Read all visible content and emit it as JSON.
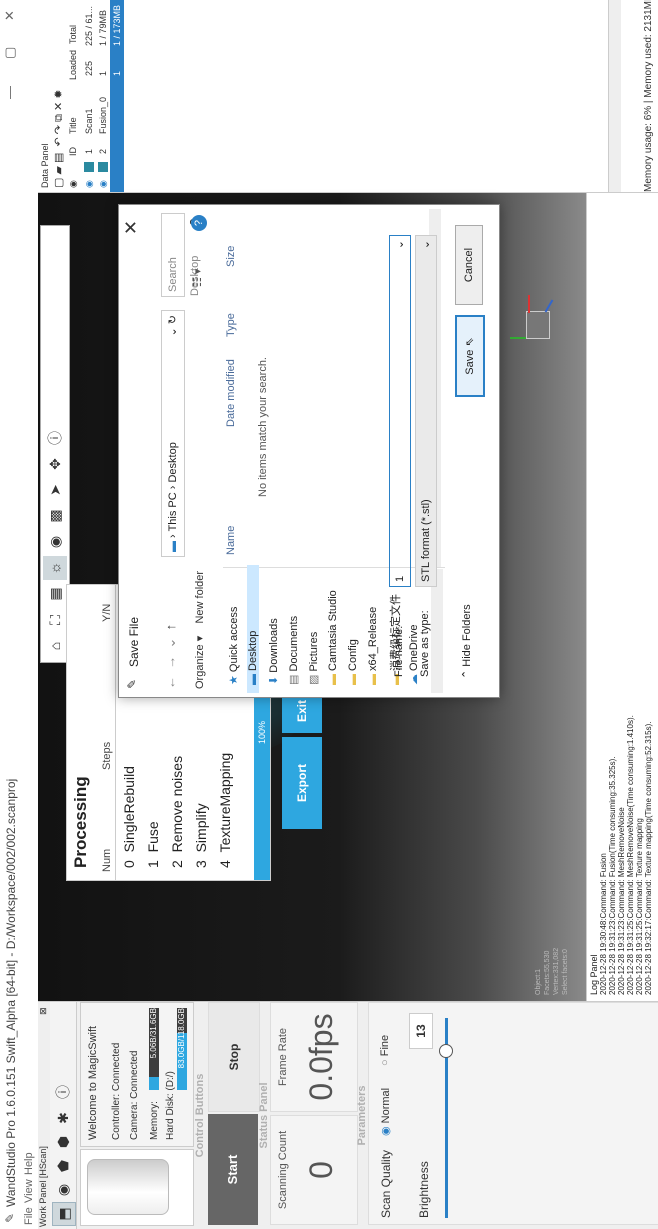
{
  "window": {
    "title": "WandStudio Pro 1.6.0.151 Swift_Alpha [64-bit] - D:/Workspace/002/002.scanproj",
    "minimize": "—",
    "maximize": "▢",
    "close": "✕"
  },
  "menu": [
    "File",
    "View",
    "Help"
  ],
  "work_panel": {
    "title": "Work Panel [HScan]",
    "welcome": "Welcome to MagicSwift",
    "controller": "Controller: Connected",
    "camera": "Camera: Connected",
    "memory_label": "Memory:",
    "memory_bar": "5.06B/31.6GB",
    "memory_fraction": 0.16,
    "disk_label": "Hard Disk: (D:/)",
    "disk_bar": "83.0GB/118.0GB",
    "disk_fraction": 0.7,
    "control_buttons_title": "Control Buttons",
    "start": "Start",
    "stop": "Stop",
    "status_title": "Status Panel",
    "scanning_count_label": "Scanning Count",
    "scanning_count": "0",
    "frame_rate_label": "Frame Rate",
    "frame_rate": "0.0fps",
    "parameters_title": "Parameters",
    "scan_quality_label": "Scan Quality",
    "quality_options": [
      "Normal",
      "Fine"
    ],
    "quality_selected": "Normal",
    "brightness_label": "Brightness",
    "brightness_value": "13"
  },
  "processing": {
    "title": "Processing",
    "col_num": "Num",
    "col_steps": "Steps",
    "col_yn": "Y/N",
    "steps": [
      {
        "num": "0",
        "name": "SingleRebuild",
        "done": "✓"
      },
      {
        "num": "1",
        "name": "Fuse",
        "done": "✓"
      },
      {
        "num": "2",
        "name": "Remove noises",
        "done": "✓"
      },
      {
        "num": "3",
        "name": "Simplify",
        "done": ""
      },
      {
        "num": "4",
        "name": "TextureMapping",
        "done": "✓"
      }
    ],
    "progress": "100%",
    "progress_fraction": 1.0,
    "export": "Export",
    "exit": "Exit"
  },
  "viewport": {
    "info": [
      "Object:1",
      "Facets:55,530",
      "Vertex:331,082",
      "Select facets:0"
    ]
  },
  "log": {
    "title": "Log Panel",
    "lines": [
      "2020-12-28 19:30:48:Command: Fusion",
      "2020-12-28 19:31:23:Command: Fusion(Time consuming:35.325s).",
      "2020-12-28 19:31:23:Command: MeshRemoveNoise",
      "2020-12-28 19:31:25:Command: MeshRemoveNoise(Time consuming:1.410s).",
      "2020-12-28 19:31:25:Command: Texture mapping",
      "2020-12-28 19:32:17:Command: Texture mapping(Time consuming:52.315s)."
    ]
  },
  "data_panel": {
    "title": "Data Panel",
    "columns": [
      "ID",
      "Title",
      "Loaded",
      "Total"
    ],
    "rows": [
      {
        "id": "1",
        "title": "Scan1",
        "loaded": "225",
        "total": "225 / 61..."
      },
      {
        "id": "2",
        "title": "Fusion_0",
        "loaded": "1",
        "total": "1 / 79MB"
      },
      {
        "id": "",
        "title": "",
        "loaded": "1",
        "total": "1 / 173MB"
      }
    ],
    "memory_usage": "Memory usage: 6% | Memory used: 2131MB"
  },
  "save_dialog": {
    "title": "Save File",
    "address": "› This PC › Desktop",
    "search_placeholder": "Search Desktop",
    "organize": "Organize ▾",
    "new_folder": "New folder",
    "nav": [
      "Quick access",
      "Desktop",
      "Downloads",
      "Documents",
      "Pictures",
      "Camtasia Studio",
      "Config",
      "x64_Release",
      "消费级标定文件",
      "OneDrive"
    ],
    "columns": [
      "Name",
      "Date modified",
      "Type",
      "Size"
    ],
    "empty_message": "No items match your search.",
    "file_name_label": "File name:",
    "file_name": "1",
    "save_as_label": "Save as type:",
    "save_as": "STL format (*.stl)",
    "hide_folders": "Hide Folders",
    "save": "Save",
    "cancel": "Cancel"
  }
}
